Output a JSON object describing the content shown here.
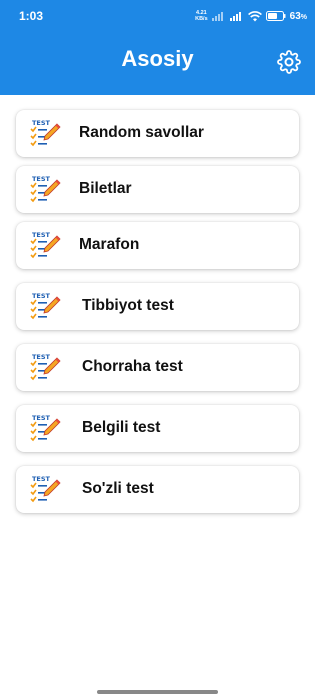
{
  "status_bar": {
    "time": "1:03",
    "net_speed_value": "4.21",
    "net_speed_unit": "KB/s",
    "battery_percent": "63",
    "battery_unit": "%"
  },
  "header": {
    "title": "Asosiy",
    "background_color": "#1e88e5",
    "settings_icon": "gear-icon"
  },
  "menu": {
    "item_icon": "test-checklist-icon",
    "items": [
      {
        "label": "Random savollar"
      },
      {
        "label": "Biletlar"
      },
      {
        "label": "Marafon"
      },
      {
        "label": "Tibbiyot test"
      },
      {
        "label": "Chorraha test"
      },
      {
        "label": "Belgili test"
      },
      {
        "label": "So'zli test"
      }
    ]
  }
}
